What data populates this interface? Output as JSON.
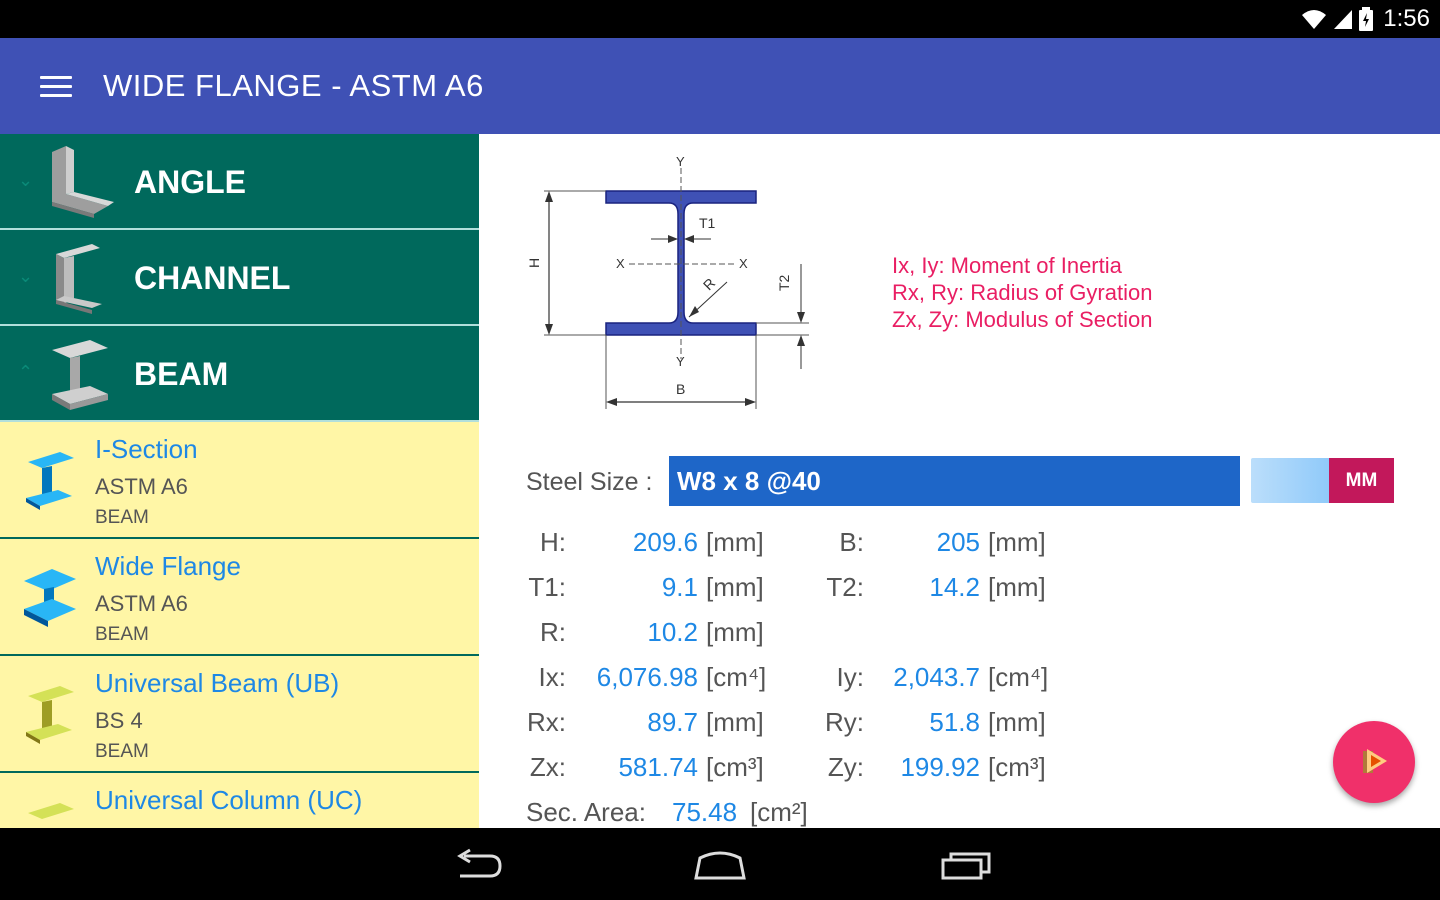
{
  "status": {
    "time": "1:56"
  },
  "appbar": {
    "title": "WIDE FLANGE - ASTM A6"
  },
  "drawer": {
    "categories": [
      {
        "label": "ANGLE"
      },
      {
        "label": "CHANNEL"
      },
      {
        "label": "BEAM"
      }
    ],
    "items": [
      {
        "title": "I-Section",
        "standard": "ASTM A6",
        "category": "BEAM"
      },
      {
        "title": "Wide Flange",
        "standard": "ASTM A6",
        "category": "BEAM"
      },
      {
        "title": "Universal Beam (UB)",
        "standard": "BS 4",
        "category": "BEAM"
      },
      {
        "title": "Universal Column (UC)",
        "standard": "",
        "category": ""
      }
    ]
  },
  "diagram": {
    "labels": {
      "y_top": "Y",
      "y_bottom": "Y",
      "x_left": "X",
      "x_right": "X",
      "t1": "T1",
      "t2": "T2",
      "h": "H",
      "b": "B",
      "r": "R"
    }
  },
  "legend": {
    "line1": "Ix, Iy: Moment of Inertia",
    "line2": "Rx, Ry: Radius of Gyration",
    "line3": "Zx, Zy: Modulus of Section"
  },
  "steel": {
    "label": "Steel Size :",
    "value": "W8 x 8 @40",
    "unit_toggle": "MM"
  },
  "props": {
    "h": {
      "label": "H:",
      "value": "209.6",
      "unit": "[mm]"
    },
    "b": {
      "label": "B:",
      "value": "205",
      "unit": "[mm]"
    },
    "t1": {
      "label": "T1:",
      "value": "9.1",
      "unit": "[mm]"
    },
    "t2": {
      "label": "T2:",
      "value": "14.2",
      "unit": "[mm]"
    },
    "r": {
      "label": "R:",
      "value": "10.2",
      "unit": "[mm]"
    },
    "ix": {
      "label": "Ix:",
      "value": "6,076.98",
      "unit": "[cm⁴]"
    },
    "iy": {
      "label": "Iy:",
      "value": "2,043.7",
      "unit": "[cm⁴]"
    },
    "rx": {
      "label": "Rx:",
      "value": "89.7",
      "unit": "[mm]"
    },
    "ry": {
      "label": "Ry:",
      "value": "51.8",
      "unit": "[mm]"
    },
    "zx": {
      "label": "Zx:",
      "value": "581.74",
      "unit": "[cm³]"
    },
    "zy": {
      "label": "Zy:",
      "value": "199.92",
      "unit": "[cm³]"
    },
    "area": {
      "label": "Sec. Area:",
      "value": "75.48",
      "unit": "[cm²]"
    }
  },
  "colors": {
    "appbar": "#3f51b5",
    "drawer_category": "#00695c",
    "drawer_item_bg": "#fff6a6",
    "accent_value": "#1e88e5",
    "legend": "#e91e63",
    "fab": "#f0306a"
  },
  "icons": {
    "menu": "hamburger-icon",
    "fab": "share-icon",
    "nav": [
      "back-icon",
      "home-icon",
      "recents-icon"
    ]
  }
}
